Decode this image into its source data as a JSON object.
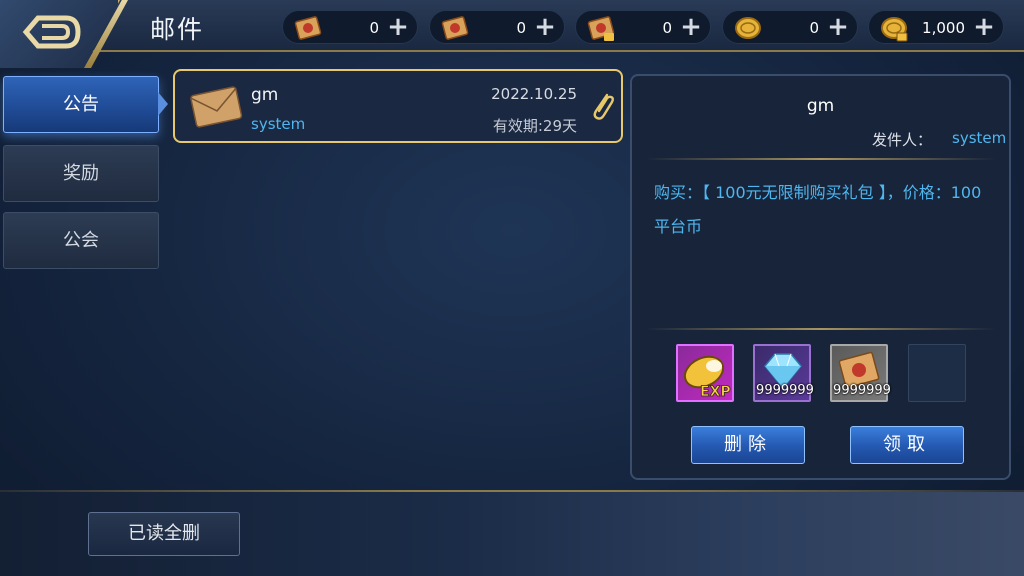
{
  "header": {
    "title": "邮件",
    "resources": [
      {
        "icon": "scroll-icon",
        "value": "0"
      },
      {
        "icon": "scroll-icon",
        "value": "0"
      },
      {
        "icon": "locked-scroll-icon",
        "value": "0"
      },
      {
        "icon": "gold-coin-icon",
        "value": "0"
      },
      {
        "icon": "locked-gold-coin-icon",
        "value": "1,000"
      }
    ],
    "plus": "+"
  },
  "tabs": [
    {
      "label": "公告",
      "active": true
    },
    {
      "label": "奖励",
      "active": false
    },
    {
      "label": "公会",
      "active": false
    }
  ],
  "mail_list": [
    {
      "sender": "gm",
      "source": "system",
      "date": "2022.10.25",
      "validity": "有效期:29天",
      "has_attachment": true
    }
  ],
  "detail": {
    "sender": "gm",
    "from_label": "发件人：",
    "from_value": "system",
    "body": "购买：【 100元无限制购买礼包 】，价格：100平台币",
    "attachments": [
      {
        "icon": "exp-potion-icon",
        "count": ""
      },
      {
        "icon": "diamond-icon",
        "count": "9999999"
      },
      {
        "icon": "scroll-icon",
        "count": "9999999"
      },
      {
        "icon": "empty-slot",
        "count": ""
      }
    ],
    "delete_label": "删除",
    "claim_label": "领取"
  },
  "footer": {
    "delete_read_label": "已读全删"
  },
  "colors": {
    "accent_blue": "#4fb6ef",
    "gold_border": "#e7c86a",
    "button_blue": "#2458b0"
  }
}
